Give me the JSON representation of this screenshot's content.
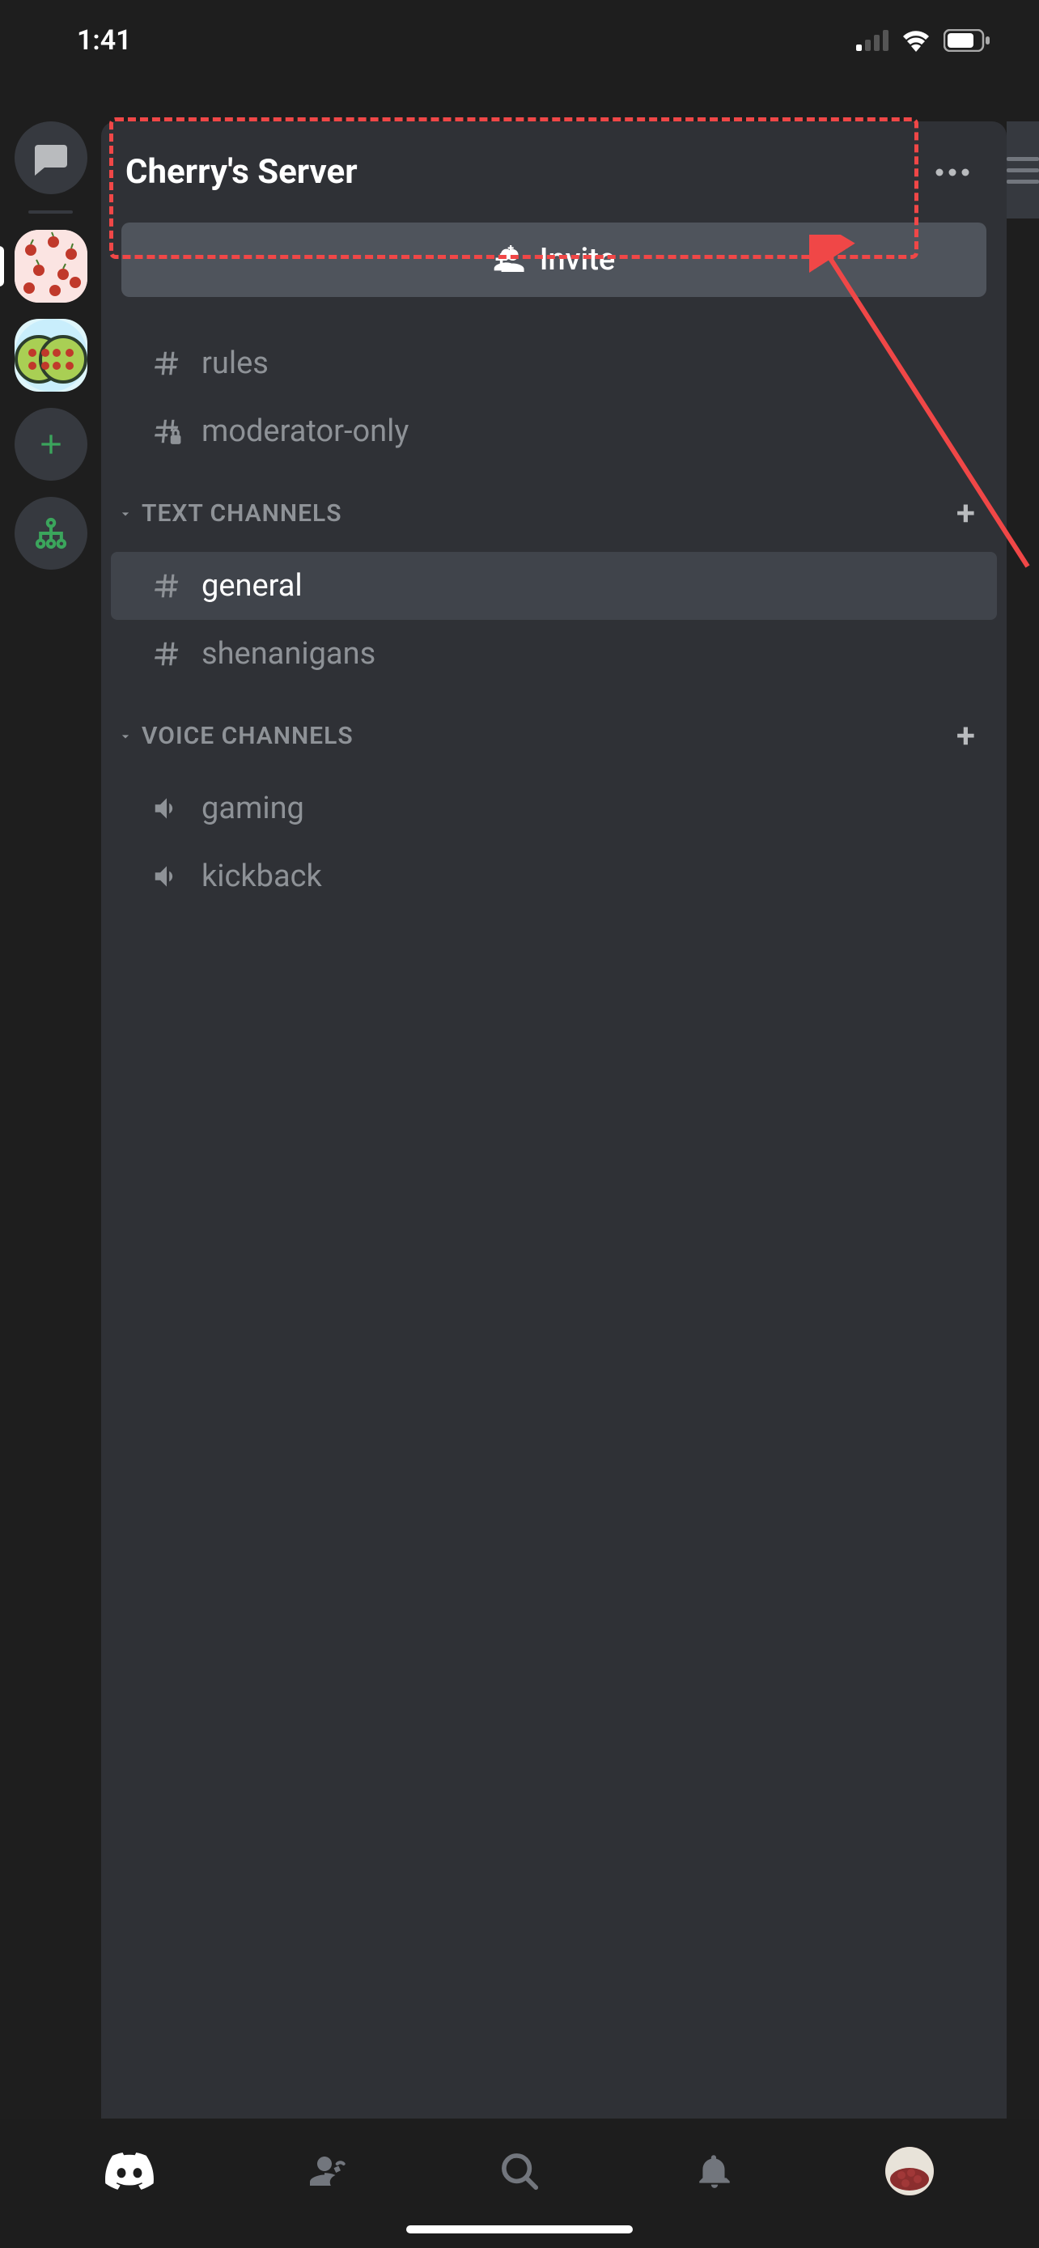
{
  "status": {
    "time": "1:41"
  },
  "server": {
    "name": "Cherry's Server",
    "invite_label": "Invite"
  },
  "top_channels": [
    {
      "name": "rules",
      "type": "text",
      "private": false
    },
    {
      "name": "moderator-only",
      "type": "text",
      "private": true
    }
  ],
  "categories": [
    {
      "label": "TEXT CHANNELS",
      "channels": [
        {
          "name": "general",
          "type": "text",
          "selected": true
        },
        {
          "name": "shenanigans",
          "type": "text",
          "selected": false
        }
      ]
    },
    {
      "label": "VOICE CHANNELS",
      "channels": [
        {
          "name": "gaming",
          "type": "voice",
          "selected": false
        },
        {
          "name": "kickback",
          "type": "voice",
          "selected": false
        }
      ]
    }
  ]
}
